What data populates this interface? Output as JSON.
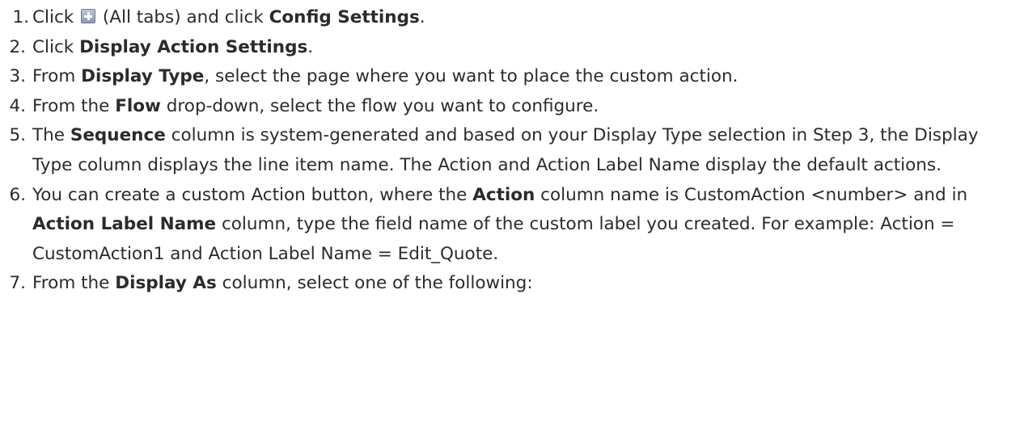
{
  "steps": [
    {
      "num": "1.",
      "parts": [
        "Click ",
        "icon:plus",
        " (All tabs) and click ",
        "b:Config Settings",
        "."
      ]
    },
    {
      "num": "2.",
      "parts": [
        "Click ",
        "b:Display Action Settings",
        "."
      ]
    },
    {
      "num": "3.",
      "parts": [
        "From ",
        "b:Display Type",
        ", select the page where you want to place the custom action."
      ]
    },
    {
      "num": "4.",
      "parts": [
        "From the ",
        "b:Flow",
        " drop-down, select the flow you want to configure."
      ]
    },
    {
      "num": "5.",
      "parts": [
        "The ",
        "b:Sequence",
        " column is system-generated and based on your Display Type selection in Step 3, the Display Type column displays the line item name. The Action and Action Label Name display the default actions."
      ]
    },
    {
      "num": "6.",
      "parts": [
        "You can create a custom Action button, where the ",
        "b:Action",
        " column name is CustomAction <number> and in ",
        "b:Action Label Name",
        " column, type the field name of the custom label you created. For example: Action = CustomAction1 and Action Label Name = Edit_Quote."
      ]
    },
    {
      "num": "7.",
      "parts": [
        "From the ",
        "b:Display As",
        " column, select one of the following:"
      ]
    }
  ]
}
